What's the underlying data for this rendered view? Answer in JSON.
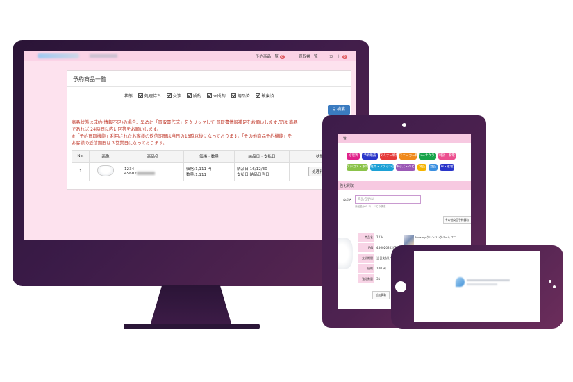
{
  "desktop": {
    "nav": [
      {
        "label": "予約商品一覧",
        "badge": "0"
      },
      {
        "label": "買取書一覧",
        "badge": ""
      },
      {
        "label": "カート",
        "badge": "0"
      }
    ],
    "panel_title": "予約商品一覧",
    "status_label": "状態",
    "status_options": [
      "処理待ち",
      "交渉",
      "成約",
      "未成約",
      "納品済",
      "破棄済"
    ],
    "search_label": "検索",
    "notices": [
      "商品状態は成約(情報不足)の場合、早めに「買取書作成」をクリックして 買取書情報補足をお願いします,又は 商品",
      "であれば 24時間以内に回答をお願いします。",
      "※「予約買取機能」利用されたお客様の返信期間は当日の18時以後になっております。「その他商品予約機能」を",
      "お客様の返信期間は３営業日になっております。"
    ],
    "table": {
      "headers": [
        "No.",
        "画像",
        "商品名",
        "価格・数量",
        "納品日・支払日",
        "状態"
      ],
      "rows": [
        {
          "no": "1",
          "name1": "1234",
          "name2": "45602",
          "price": "価格:1,111 円",
          "qty": "数量:1,111",
          "delivery": "納品日:16/12/30",
          "payment": "支払日:納品日当日",
          "state": "処理待ち"
        }
      ]
    }
  },
  "tablet": {
    "header": "一覧",
    "chips": [
      {
        "label": "処理済",
        "color": "#e0218a"
      },
      {
        "label": "予約販売",
        "color": "#2a36c9"
      },
      {
        "label": "スムナー特集",
        "color": "#e53a3a"
      },
      {
        "label": "スニーカー特集",
        "color": "#f08a1c"
      },
      {
        "label": "シーナクラブ",
        "color": "#18a44a"
      },
      {
        "label": "時計・家電",
        "color": "#ec4f8f"
      },
      {
        "label": "デジカメ・家電",
        "color": "#8bc34a"
      },
      {
        "label": "雑貨・ファッション",
        "color": "#1da1d6"
      },
      {
        "label": "キッズ・ベビー",
        "color": "#9b59b6"
      },
      {
        "label": "食品",
        "color": "#f5b400"
      },
      {
        "label": "酒品",
        "color": "#3b8fe0"
      },
      {
        "label": "車・家電",
        "color": "#2a36c9"
      }
    ],
    "section_title": "強化買取",
    "search_label": "商品名",
    "search_placeholder": "商品名/JAN",
    "search_hint": "商品名/JAN コードでの検索",
    "other_button": "その他商品予約買取",
    "detail_rows": [
      {
        "label": "商品名",
        "value": "1234"
      },
      {
        "label": "JAN",
        "value": "4560202020202"
      },
      {
        "label": "支払期間",
        "value": "当日支払(入金日)"
      },
      {
        "label": "価格",
        "value": "100 円"
      },
      {
        "label": "強化数量",
        "value": "31"
      }
    ],
    "side_text": "Nursery クレンジングバーム エコ",
    "footer_button": "追加買取"
  }
}
